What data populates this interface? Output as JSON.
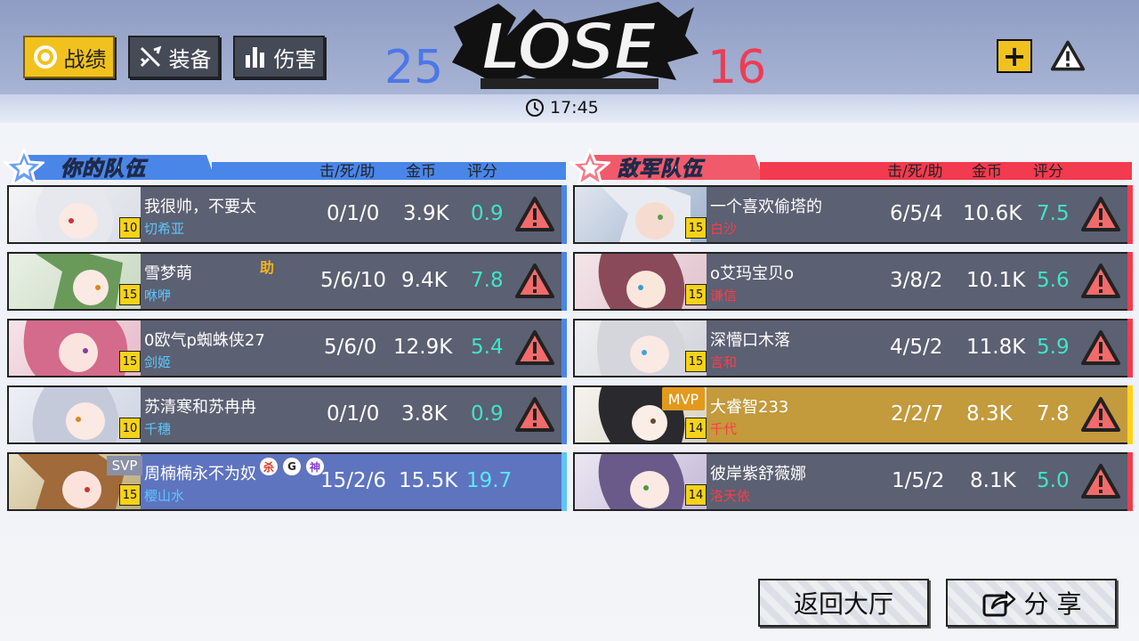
{
  "tabs": [
    {
      "label": "战绩",
      "icon": "ring-icon",
      "active": true
    },
    {
      "label": "装备",
      "icon": "sword-icon",
      "active": false
    },
    {
      "label": "伤害",
      "icon": "bar-chart-icon",
      "active": false
    }
  ],
  "result": {
    "title": "LOSE",
    "score_blue": "25",
    "score_red": "16"
  },
  "timer": {
    "time": "17:45",
    "icon": "clock-icon"
  },
  "buttons_top": {
    "add": "+",
    "warn_icon": "warning-icon"
  },
  "teams": {
    "mine": {
      "name": "你的队伍",
      "columns": {
        "kda": "击/死/助",
        "gold": "金币",
        "rating": "评分"
      },
      "players": [
        {
          "name": "我很帅，不要太",
          "hero": "切希亚",
          "level": "10",
          "kda": "0/1/0",
          "gold": "3.9K",
          "rating": "0.9"
        },
        {
          "name": "雪梦萌",
          "hero": "咻咿",
          "level": "15",
          "kda": "5/6/10",
          "gold": "9.4K",
          "rating": "7.8",
          "tags": [
            "助"
          ]
        },
        {
          "name": "0欧气p蜘蛛侠27",
          "hero": "剑姬",
          "level": "15",
          "kda": "5/6/0",
          "gold": "12.9K",
          "rating": "5.4"
        },
        {
          "name": "苏清寒和苏冉冉",
          "hero": "千穗",
          "level": "10",
          "kda": "0/1/0",
          "gold": "3.8K",
          "rating": "0.9"
        },
        {
          "name": "周楠楠永不为奴",
          "hero": "樱山水",
          "level": "15",
          "kda": "15/2/6",
          "gold": "15.5K",
          "rating": "19.7",
          "badge": "SVP",
          "tags": [
            "杀",
            "G",
            "神"
          ]
        }
      ]
    },
    "enemy": {
      "name": "敌军队伍",
      "columns": {
        "kda": "击/死/助",
        "gold": "金币",
        "rating": "评分"
      },
      "players": [
        {
          "name": "一个喜欢偷塔的",
          "hero": "白沙",
          "level": "15",
          "kda": "6/5/4",
          "gold": "10.6K",
          "rating": "7.5"
        },
        {
          "name": "o艾玛宝贝o",
          "hero": "谦信",
          "level": "15",
          "kda": "3/8/2",
          "gold": "10.1K",
          "rating": "5.6"
        },
        {
          "name": "深懵口木落",
          "hero": "言和",
          "level": "15",
          "kda": "4/5/2",
          "gold": "11.8K",
          "rating": "5.9"
        },
        {
          "name": "大睿智233",
          "hero": "千代",
          "level": "14",
          "kda": "2/2/7",
          "gold": "8.3K",
          "rating": "7.8",
          "badge": "MVP"
        },
        {
          "name": "彼岸紫舒薇娜",
          "hero": "洛天依",
          "level": "14",
          "kda": "1/5/2",
          "gold": "8.1K",
          "rating": "5.0"
        }
      ]
    }
  },
  "bottom": {
    "back": "返回大厅",
    "share": "分 享"
  },
  "colors": {
    "gold": "#f1c21e",
    "blue_team": "#4d77e6",
    "red_team": "#ec3d55",
    "rating": "#3ce6c9"
  }
}
